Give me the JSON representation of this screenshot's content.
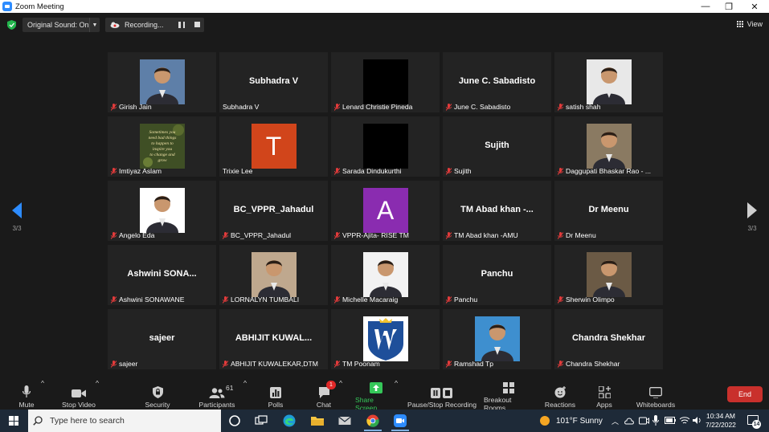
{
  "window": {
    "title": "Zoom Meeting",
    "minimize": "—",
    "maximize": "❐",
    "close": "✕"
  },
  "topbar": {
    "original_sound": "Original Sound: On",
    "recording": "Recording...",
    "view_label": "View"
  },
  "gallery": {
    "page_indicator": "3/3",
    "tiles": [
      {
        "name": "Girish Jain",
        "video": "photo",
        "muted": true,
        "bg": "#5e7fa8"
      },
      {
        "name": "Subhadra V",
        "display_name": "Subhadra V",
        "video": "none",
        "muted": false
      },
      {
        "name": "Lenard Christie Pineda",
        "video": "black",
        "muted": true
      },
      {
        "name": "June C. Sabadisto",
        "display_name": "June C. Sabadisto",
        "video": "none",
        "muted": true
      },
      {
        "name": "satish shah",
        "video": "photo",
        "muted": true,
        "bg": "#e8e8e8"
      },
      {
        "name": "Imtiyaz Aslam",
        "video": "quote",
        "muted": true,
        "quote": "Sometimes you need bad things to happen to inspire you to change and grow"
      },
      {
        "name": "Trixie Lee",
        "video": "initial",
        "initial": "T",
        "avatar_color": "#d1451b",
        "muted": false
      },
      {
        "name": "Sarada Dindukurthi",
        "video": "black",
        "muted": true
      },
      {
        "name": "Sujith",
        "display_name": "Sujith",
        "video": "none",
        "muted": true
      },
      {
        "name": "Daggupati Bhaskar Rao - ...",
        "video": "photo",
        "muted": true,
        "bg": "#8a7a62"
      },
      {
        "name": "Angelo Eda",
        "video": "photo",
        "muted": true,
        "bg": "#ffffff"
      },
      {
        "name": "BC_VPPR_Jahadul",
        "display_name": "BC_VPPR_Jahadul",
        "video": "none",
        "muted": true
      },
      {
        "name": "VPPR-Ajita- RISE TM",
        "video": "initial",
        "initial": "A",
        "avatar_color": "#8a2cb0",
        "muted": true
      },
      {
        "name": "TM Abad khan -AMU",
        "display_name": "TM Abad khan -...",
        "video": "none",
        "muted": true
      },
      {
        "name": "Dr Meenu",
        "display_name": "Dr Meenu",
        "video": "none",
        "muted": true
      },
      {
        "name": "Ashwini SONAWANE",
        "display_name": "Ashwini SONA...",
        "video": "none",
        "muted": true
      },
      {
        "name": "LORNALYN TUMBALI",
        "video": "photo",
        "muted": true,
        "bg": "#bfa88e"
      },
      {
        "name": "Michelle Macaraig",
        "video": "photo",
        "muted": true,
        "bg": "#f2f2f2"
      },
      {
        "name": "Panchu",
        "display_name": "Panchu",
        "video": "none",
        "muted": true
      },
      {
        "name": "Sherwin Olimpo",
        "video": "photo",
        "muted": true,
        "bg": "#6b5a45"
      },
      {
        "name": "sajeer",
        "display_name": "sajeer",
        "video": "none",
        "muted": true
      },
      {
        "name": "ABHIJIT KUWALEKAR,DTM",
        "display_name": "ABHIJIT KUWAL...",
        "video": "none",
        "muted": true
      },
      {
        "name": "TM Poonam",
        "video": "logo_w",
        "muted": true,
        "bg": "#1e4f9a"
      },
      {
        "name": "Ramshad Tp",
        "video": "photo",
        "muted": true,
        "bg": "#3e8fcf"
      },
      {
        "name": "Chandra Shekhar",
        "display_name": "Chandra Shekhar",
        "video": "none",
        "muted": true
      }
    ]
  },
  "toolbar": {
    "mute": "Mute",
    "stop_video": "Stop Video",
    "security": "Security",
    "participants": "Participants",
    "participants_count": "61",
    "polls": "Polls",
    "chat": "Chat",
    "chat_badge": "1",
    "share_screen": "Share Screen",
    "pause_stop_recording": "Pause/Stop Recording",
    "breakout_rooms": "Breakout Rooms",
    "reactions": "Reactions",
    "apps": "Apps",
    "whiteboards": "Whiteboards",
    "end": "End"
  },
  "taskbar": {
    "search_placeholder": "Type here to search",
    "weather": "101°F  Sunny",
    "time": "10:34 AM",
    "date": "7/22/2022",
    "notifications": "14"
  },
  "colors": {
    "accent": "#2d8cff",
    "share_green": "#35c759",
    "end_red": "#c9302c",
    "taskbar": "#1e2a38"
  }
}
